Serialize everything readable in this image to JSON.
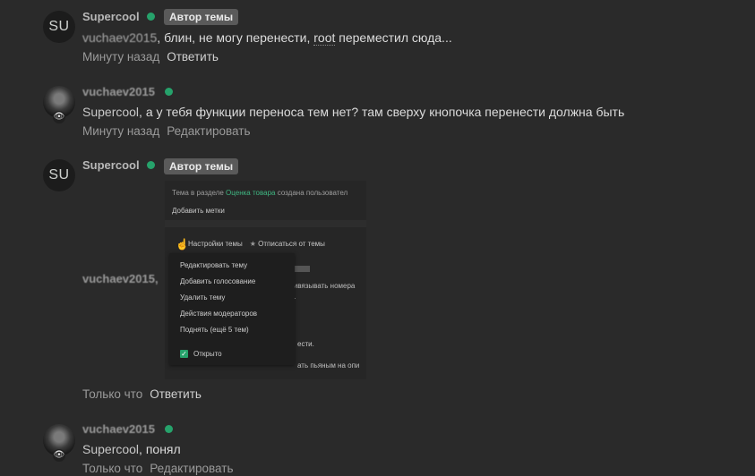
{
  "posts": [
    {
      "avatar": "SU",
      "author": "Supercool",
      "badge": "Автор темы",
      "mention": "vuchaev2015",
      "text_before_root": ", блин, не могу перенести, ",
      "root": "root",
      "text_after_root": " переместил сюда...",
      "time": "Минуту назад",
      "action": "Ответить"
    },
    {
      "avatar_icon": "user-photo",
      "author": "vuchaev2015",
      "mention": "Supercool",
      "text": ", а у тебя функции переноса тем нет? там сверху кнопочка перенести должна быть",
      "time": "Минуту назад",
      "action": "Редактировать"
    },
    {
      "avatar": "SU",
      "author": "Supercool",
      "badge": "Автор темы",
      "mention": "vuchaev2015,",
      "time": "Только что",
      "action": "Ответить",
      "screenshot": {
        "line1_prefix": "Тема в разделе ",
        "line1_link": "Оценка товара",
        "line1_suffix": " создана пользовател",
        "add_tags": "Добавить метки",
        "settings": "Настройки темы",
        "unsubscribe": "Отписаться от темы",
        "menu": [
          "Редактировать тему",
          "Добавить голосование",
          "Удалить тему",
          "Действия модераторов",
          "Поднять (ещё 5 тем)"
        ],
        "open_label": "Открыто",
        "bg_text1": "привязывать номера",
        "bg_text2": "ести.",
        "bg_text3": "ать пьяным на опи"
      }
    },
    {
      "avatar_icon": "user-photo",
      "author": "vuchaev2015",
      "mention": "Supercool",
      "text": ", понял",
      "time": "Только что",
      "action": "Редактировать"
    }
  ],
  "colors": {
    "online": "#26a26b",
    "background": "#2a2a2a"
  }
}
